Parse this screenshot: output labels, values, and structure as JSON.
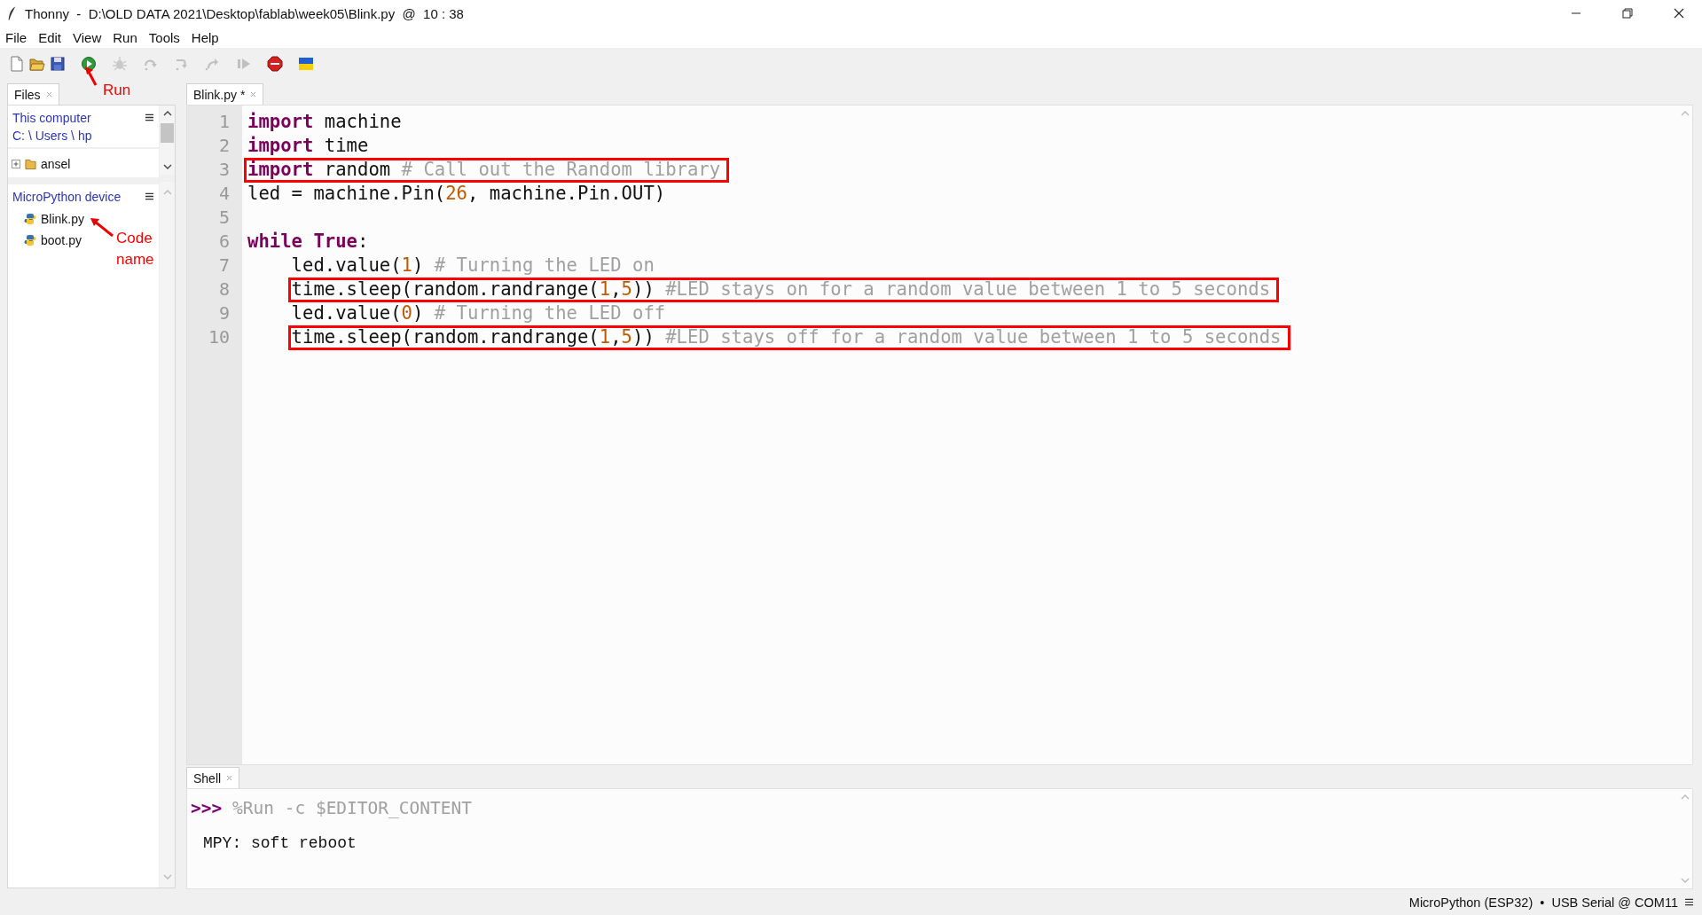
{
  "window": {
    "title": "Thonny  -  D:\\OLD DATA 2021\\Desktop\\fablab\\week05\\Blink.py  @  10 : 38"
  },
  "menu": [
    "File",
    "Edit",
    "View",
    "Run",
    "Tools",
    "Help"
  ],
  "toolbar": [
    {
      "kind": "new",
      "disabled": false
    },
    {
      "kind": "open",
      "disabled": false
    },
    {
      "kind": "save",
      "disabled": false
    },
    {
      "kind": "run",
      "disabled": false
    },
    {
      "kind": "debug",
      "disabled": true
    },
    {
      "kind": "step-over",
      "disabled": true
    },
    {
      "kind": "step-into",
      "disabled": true
    },
    {
      "kind": "step-out",
      "disabled": true
    },
    {
      "kind": "resume",
      "disabled": true
    },
    {
      "kind": "stop",
      "disabled": false
    },
    {
      "kind": "flag",
      "disabled": false
    }
  ],
  "files_panel": {
    "tab": {
      "label": "Files",
      "selected": true
    },
    "sections": [
      {
        "title": "This computer",
        "path": "C: \\ Users \\ hp",
        "items": [
          {
            "kind": "folder",
            "name": "ansel",
            "expanded": false
          }
        ]
      },
      {
        "title": "MicroPython device",
        "items": [
          {
            "kind": "python",
            "name": "Blink.py"
          },
          {
            "kind": "python",
            "name": "boot.py"
          }
        ]
      }
    ]
  },
  "editor": {
    "tabs": [
      {
        "label": "Blink.py *",
        "selected": true
      }
    ],
    "lines": [
      {
        "number": "1",
        "indented": false,
        "boxed": false,
        "tokens": [
          {
            "kind": "keyword",
            "text": "import"
          },
          {
            "kind": "plain",
            "text": " machine"
          }
        ]
      },
      {
        "number": "2",
        "indented": false,
        "boxed": false,
        "tokens": [
          {
            "kind": "keyword",
            "text": "import"
          },
          {
            "kind": "plain",
            "text": " time"
          }
        ]
      },
      {
        "number": "3",
        "indented": false,
        "boxed": true,
        "tokens": [
          {
            "kind": "keyword",
            "text": "import"
          },
          {
            "kind": "plain",
            "text": " random "
          },
          {
            "kind": "comment",
            "text": "# Call out the Random library"
          }
        ]
      },
      {
        "number": "4",
        "indented": false,
        "boxed": false,
        "tokens": [
          {
            "kind": "plain",
            "text": "led = machine.Pin("
          },
          {
            "kind": "number",
            "text": "26"
          },
          {
            "kind": "plain",
            "text": ", machine.Pin.OUT)"
          }
        ]
      },
      {
        "number": "5"
      },
      {
        "number": "6",
        "indented": false,
        "boxed": false,
        "tokens": [
          {
            "kind": "keyword",
            "text": "while"
          },
          {
            "kind": "keyword",
            "text": " True"
          },
          {
            "kind": "plain",
            "text": ":"
          }
        ]
      },
      {
        "number": "7",
        "indented": true,
        "boxed": false,
        "tokens": [
          {
            "kind": "plain",
            "text": "led.value("
          },
          {
            "kind": "number",
            "text": "1"
          },
          {
            "kind": "plain",
            "text": ") "
          },
          {
            "kind": "comment",
            "text": "# Turning the LED on"
          }
        ]
      },
      {
        "number": "8",
        "indented": true,
        "boxed": true,
        "tokens": [
          {
            "kind": "plain",
            "text": "time.sleep(random.randrange("
          },
          {
            "kind": "number",
            "text": "1"
          },
          {
            "kind": "plain",
            "text": ","
          },
          {
            "kind": "number",
            "text": "5"
          },
          {
            "kind": "plain",
            "text": ")) "
          },
          {
            "kind": "comment",
            "text": "#LED stays on for a random value between 1 to 5 seconds"
          }
        ]
      },
      {
        "number": "9",
        "indented": true,
        "boxed": false,
        "tokens": [
          {
            "kind": "plain",
            "text": "led.value("
          },
          {
            "kind": "number",
            "text": "0"
          },
          {
            "kind": "plain",
            "text": ") "
          },
          {
            "kind": "comment",
            "text": "# Turning the LED off"
          }
        ]
      },
      {
        "number": "10",
        "indented": true,
        "boxed": true,
        "tokens": [
          {
            "kind": "plain",
            "text": "time.sleep(random.randrange("
          },
          {
            "kind": "number",
            "text": "1"
          },
          {
            "kind": "plain",
            "text": ","
          },
          {
            "kind": "number",
            "text": "5"
          },
          {
            "kind": "plain",
            "text": ")) "
          },
          {
            "kind": "comment",
            "text": "#LED stays off for a random value between 1 to 5 seconds"
          }
        ]
      }
    ]
  },
  "shell": {
    "tab": {
      "label": "Shell",
      "selected": true
    },
    "lines": [
      {
        "kind": "command",
        "prompt": ">>>",
        "text": "%Run -c $EDITOR_CONTENT"
      },
      {
        "kind": "output",
        "text": "MPY: soft reboot"
      }
    ]
  },
  "status_bar": {
    "text": "MicroPython (ESP32)  •  USB Serial @ COM11"
  },
  "annotations": [
    {
      "kind": "run",
      "text": "Run"
    },
    {
      "kind": "file",
      "text": "Code name"
    }
  ]
}
